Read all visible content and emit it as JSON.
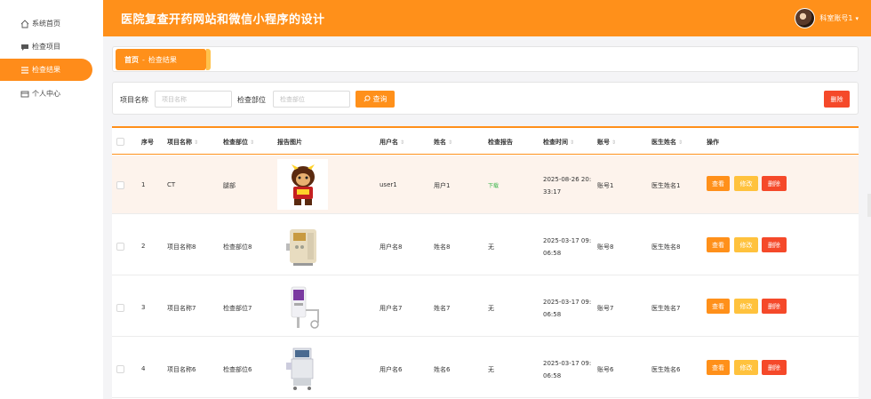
{
  "sidebar": {
    "items": [
      {
        "label": "系统首页",
        "icon": "home-icon"
      },
      {
        "label": "检查项目",
        "icon": "chat-icon"
      },
      {
        "label": "检查结果",
        "icon": "list-icon"
      },
      {
        "label": "个人中心",
        "icon": "card-icon"
      }
    ]
  },
  "header": {
    "title": "医院复查开药网站和微信小程序的设计",
    "user": "科室账号1"
  },
  "breadcrumb": {
    "home": "首页",
    "sep": "-",
    "current": "检查结果"
  },
  "search": {
    "label1": "项目名称",
    "placeholder1": "项目名称",
    "label2": "检查部位",
    "placeholder2": "检查部位",
    "query": "查询",
    "delete": "删除"
  },
  "table": {
    "headers": [
      "序号",
      "项目名称",
      "检查部位",
      "报告图片",
      "用户名",
      "姓名",
      "检查报告",
      "检查时间",
      "账号",
      "医生姓名",
      "操作"
    ],
    "rows": [
      {
        "no": "1",
        "name": "CT",
        "part": "腿部",
        "user": "user1",
        "realname": "用户1",
        "report": "下载",
        "time1": "2025-08-26 20:",
        "time2": "33:17",
        "account": "账号1",
        "doctor": "医生姓名1"
      },
      {
        "no": "2",
        "name": "项目名称8",
        "part": "检查部位8",
        "user": "用户名8",
        "realname": "姓名8",
        "report": "无",
        "time1": "2025-03-17 09:",
        "time2": "06:58",
        "account": "账号8",
        "doctor": "医生姓名8"
      },
      {
        "no": "3",
        "name": "项目名称7",
        "part": "检查部位7",
        "user": "用户名7",
        "realname": "姓名7",
        "report": "无",
        "time1": "2025-03-17 09:",
        "time2": "06:58",
        "account": "账号7",
        "doctor": "医生姓名7"
      },
      {
        "no": "4",
        "name": "项目名称6",
        "part": "检查部位6",
        "user": "用户名6",
        "realname": "姓名6",
        "report": "无",
        "time1": "2025-03-17 09:",
        "time2": "06:58",
        "account": "账号6",
        "doctor": "医生姓名6"
      }
    ],
    "actions": {
      "view": "查看",
      "edit": "修改",
      "delete": "删除"
    }
  },
  "colors": {
    "accent": "#ff901a",
    "warn": "#ffc23d",
    "danger": "#f5492a",
    "link": "#39b54a"
  }
}
